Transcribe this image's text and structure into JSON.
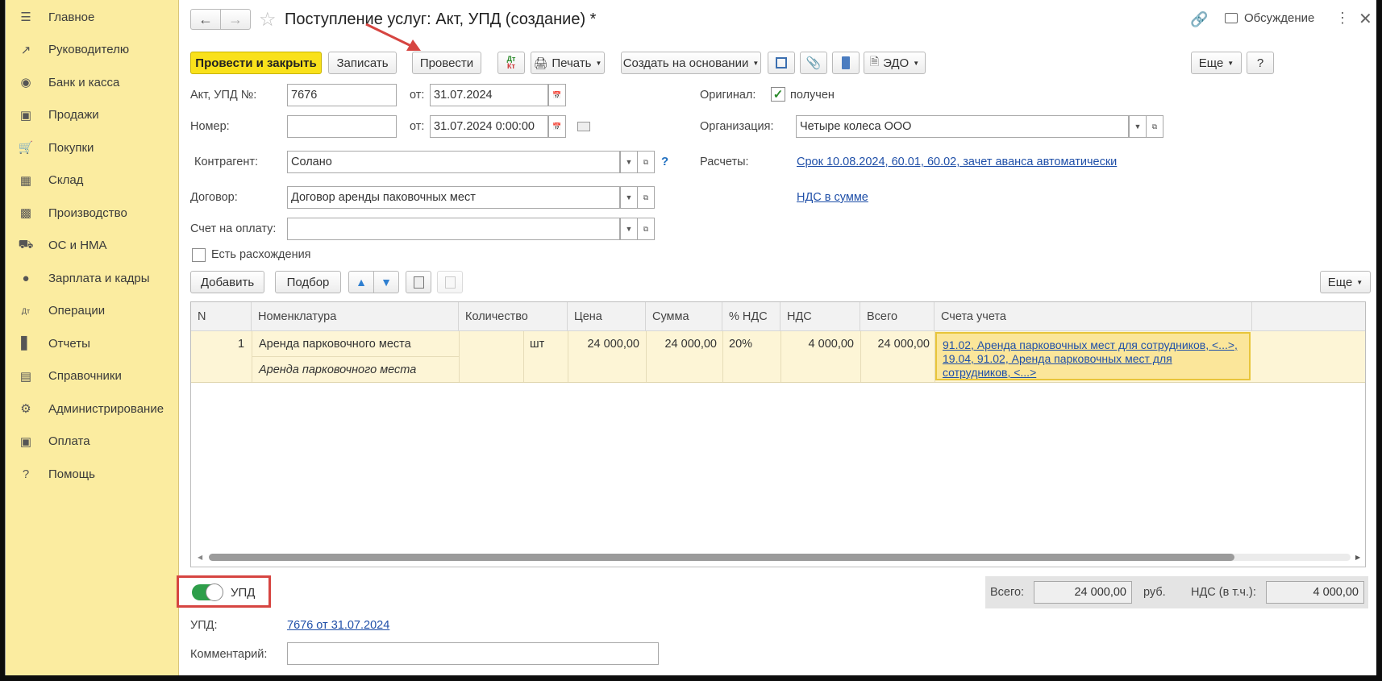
{
  "sidebar": {
    "items": [
      {
        "icon": "menu-icon",
        "label": "Главное"
      },
      {
        "icon": "trend-icon",
        "label": "Руководителю"
      },
      {
        "icon": "coin-icon",
        "label": "Банк и касса"
      },
      {
        "icon": "bag-icon",
        "label": "Продажи"
      },
      {
        "icon": "cart-icon",
        "label": "Покупки"
      },
      {
        "icon": "grid-icon",
        "label": "Склад"
      },
      {
        "icon": "factory-icon",
        "label": "Производство"
      },
      {
        "icon": "truck-icon",
        "label": "ОС и НМА"
      },
      {
        "icon": "person-icon",
        "label": "Зарплата и кадры"
      },
      {
        "icon": "dt-kt-icon",
        "label": "Операции"
      },
      {
        "icon": "bar-chart-icon",
        "label": "Отчеты"
      },
      {
        "icon": "books-icon",
        "label": "Справочники"
      },
      {
        "icon": "gear-icon",
        "label": "Администрирование"
      },
      {
        "icon": "wallet-icon",
        "label": "Оплата"
      },
      {
        "icon": "help-icon",
        "label": "Помощь"
      }
    ]
  },
  "header": {
    "title": "Поступление услуг: Акт, УПД (создание) *",
    "discussion": "Обсуждение"
  },
  "toolbar": {
    "post_close": "Провести и закрыть",
    "save": "Записать",
    "post": "Провести",
    "print": "Печать",
    "create_based": "Создать на основании",
    "edo": "ЭДО",
    "more": "Еще",
    "help": "?"
  },
  "form": {
    "act_label": "Акт, УПД №:",
    "act_number": "7676",
    "from_label": "от:",
    "act_date": "31.07.2024",
    "number_label": "Номер:",
    "number_value": "",
    "number_date": "31.07.2024  0:00:00",
    "original_label": "Оригинал:",
    "original_received": "получен",
    "org_label": "Организация:",
    "org_value": "Четыре колеса ООО",
    "contractor_label": "Контрагент:",
    "contractor_value": "Солано",
    "help_q": "?",
    "payments_label": "Расчеты:",
    "payments_link": "Срок 10.08.2024, 60.01, 60.02, зачет аванса автоматически",
    "contract_label": "Договор:",
    "contract_value": "Договор аренды паковочных мест",
    "vat_link": "НДС в сумме",
    "invoice_label": "Счет на оплату:",
    "invoice_value": "",
    "discrepancy_label": "Есть расхождения"
  },
  "table_toolbar": {
    "add": "Добавить",
    "pick": "Подбор",
    "more": "Еще"
  },
  "table": {
    "columns": [
      "N",
      "Номенклатура",
      "Количество",
      "Цена",
      "Сумма",
      "% НДС",
      "НДС",
      "Всего",
      "Счета учета"
    ],
    "rows": [
      {
        "n": "1",
        "name": "Аренда парковочного места",
        "name2": "Аренда парковочного места",
        "unit": "шт",
        "price": "24 000,00",
        "sum": "24 000,00",
        "vat_rate": "20%",
        "vat": "4 000,00",
        "total": "24 000,00",
        "accounts": "91.02, Аренда парковочных мест для сотрудников, <...>, 19.04, 91.02, Аренда парковочных мест для сотрудников, <...>"
      }
    ]
  },
  "footer": {
    "upd_toggle": "УПД",
    "total_label": "Всего:",
    "total_value": "24 000,00",
    "currency": "руб.",
    "vat_label": "НДС (в т.ч.):",
    "vat_value": "4 000,00",
    "upd_label": "УПД:",
    "upd_link": "7676 от 31.07.2024",
    "comment_label": "Комментарий:",
    "comment_value": ""
  },
  "colors": {
    "sidebar_bg": "#fbeca0",
    "primary_button": "#f9e11b",
    "link": "#1f4fa8",
    "annotation": "#d64541",
    "toggle_on": "#2e9e4a"
  }
}
